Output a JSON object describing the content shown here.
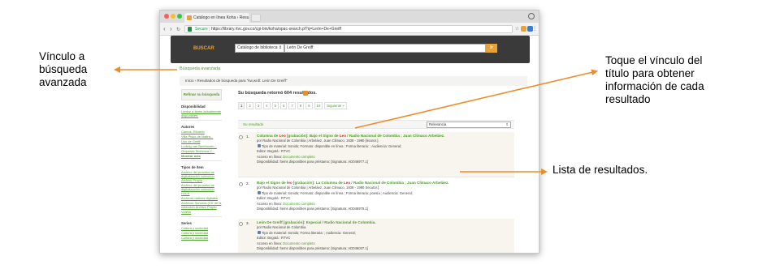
{
  "annotations": {
    "advanced_search": "Vínculo a búsqueda avanzada",
    "touch_link": "Toque el vínculo del título para obtener información de cada resultado",
    "result_list": "Lista de resultados."
  },
  "browser": {
    "tab_title": "Catálogo en línea Koha › Resu",
    "secure_label": "Secure",
    "url": "https://library.rtvc.gov.co/cgi-bin/koha/opac-search.pl?q=León+De+Greiff"
  },
  "header": {
    "buscar_label": "BUSCAR",
    "search_scope": "Catálogo de biblioteca",
    "search_value": "León De Greiff",
    "go_label": "Ir"
  },
  "advanced_link": "Búsqueda avanzada",
  "breadcrumb": "Inicio  ›  Resultados de búsqueda para \"kw,wrdl: León De Greiff\"",
  "sidebar": {
    "refine_label": "Refinar su búsqueda",
    "availability_heading": "Disponibilidad",
    "availability_link": "Limitar a ítems actualmente disponibles.",
    "authors_heading": "Autores",
    "authors": [
      "Cantos, Ricardo",
      "Villa Pisco de Nadra...",
      "Uso de Greiff",
      "Ludwig van Beethoven...",
      "Orquesta Sinfónica C..."
    ],
    "show_more": "Mostrar más",
    "types_heading": "Tipos de ítem",
    "types": [
      "Archivo del proceso de digitalización colección Archivo Propio",
      "Archivo del proceso de digitalización colección HJCK",
      "Archivos nativos digitales",
      "Archivos Sonoros (CD de la colección Archivo Propio",
      "Videos"
    ],
    "series_heading": "Series",
    "series": [
      "Cultura y sociedad",
      "Cultura y sociedad",
      "Cultura y sociedad"
    ]
  },
  "results": {
    "count_text": "Su búsqueda retornó 604 resultados.",
    "pages": [
      "1",
      "2",
      "3",
      "4",
      "5",
      "6",
      "7",
      "8",
      "9",
      "10",
      "Siguiente »"
    ],
    "select_label": "Su resultado",
    "sort_value": "Relevancia",
    "items": [
      {
        "num": "1.",
        "title_a": "Columna de ",
        "title_kw1": "Leo",
        "title_b": " [grabación]: Bajo el Signo de ",
        "title_kw2": "Leo",
        "title_c": " / Radio Nacional de Colombia ; Juan Climaco Arbeláez.",
        "author": "por Radio Nacional de Colombia | Arbeláez, Juan Climaco, 1939 - 1990 [lecutor.].",
        "type": "Tipo de material: Sonido; Formato: disponible en línea ; Forma literaria: ; Audiencia: General;",
        "publisher": "Editor: Bogotá : RTVC",
        "access_label": "Acceso en línea:",
        "access_link": "Documento completo",
        "availability": "Disponibilidad: Ítems disponibles para préstamo: [Signatura: AD046977.1]"
      },
      {
        "num": "2.",
        "title_a": "Bajo el Signo de ",
        "title_kw1": "leo",
        "title_b": " [grabación]: La Columna de ",
        "title_kw2": "Leo",
        "title_c": " / Radio Nacional de Colombia ; Juan Climaco Arbeláez.",
        "author": "por Radio Nacional de Colombia | Arbeláez, Juan Climaco, 1939 - 1990 Secutor.].",
        "type": "Tipo de material: Sonido; Formato: disponible en línea ; Forma literaria: poesía ; Audiencia: General;",
        "publisher": "Editor: Bogotá : RTVC",
        "access_label": "Acceso en línea:",
        "access_link": "Documento completo",
        "availability": "Disponibilidad: Ítems disponibles para préstamo: [Signatura: AD046978.1]"
      },
      {
        "num": "3.",
        "title_a": "León De Greiff",
        "title_kw1": "",
        "title_b": " [grabación]: Especial / Radio Nacional de Colombia.",
        "title_kw2": "",
        "title_c": "",
        "author": "por Radio Nacional de Colombia.",
        "type": "Tipo de material: Sonido; Forma literaria: ; Audiencia: General;",
        "publisher": "Editor: Bogotá : RTVC",
        "access_label": "Acceso en línea:",
        "access_link": "Documento completo",
        "availability": "Disponibilidad: Ítems disponibles para préstamo: [Signatura: AD046037.1]"
      }
    ]
  },
  "colors": {
    "accent": "#E5A43A",
    "link_green": "#4B9E2A",
    "arrow_orange": "#EF8C2A",
    "header_dark": "#3A3A3A"
  }
}
